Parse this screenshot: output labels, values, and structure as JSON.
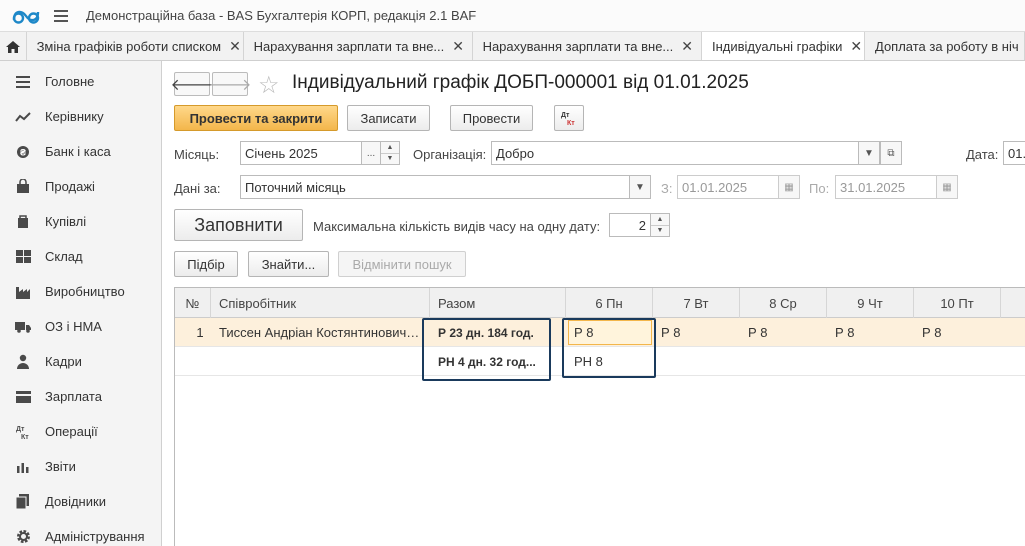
{
  "app": {
    "title": "Демонстраційна база - BAS Бухгалтерія КОРП, редакція 2.1 BAF"
  },
  "tabs": [
    {
      "label": "Зміна графіків роботи списком"
    },
    {
      "label": "Нарахування зарплати та вне..."
    },
    {
      "label": "Нарахування зарплати та вне..."
    },
    {
      "label": "Індивідуальні графіки"
    },
    {
      "label": "Доплата за роботу в ніч"
    }
  ],
  "sidebar": {
    "items": [
      {
        "label": "Головне",
        "icon": "menu-lines-icon"
      },
      {
        "label": "Керівнику",
        "icon": "trend-chart-icon"
      },
      {
        "label": "Банк і каса",
        "icon": "coin-icon"
      },
      {
        "label": "Продажі",
        "icon": "shopping-bag-icon"
      },
      {
        "label": "Купівлі",
        "icon": "cart-icon"
      },
      {
        "label": "Склад",
        "icon": "warehouse-icon"
      },
      {
        "label": "Виробництво",
        "icon": "factory-icon"
      },
      {
        "label": "ОЗ і НМА",
        "icon": "truck-icon"
      },
      {
        "label": "Кадри",
        "icon": "person-icon"
      },
      {
        "label": "Зарплата",
        "icon": "wallet-icon"
      },
      {
        "label": "Операції",
        "icon": "dt-kt-icon"
      },
      {
        "label": "Звіти",
        "icon": "bar-chart-icon"
      },
      {
        "label": "Довідники",
        "icon": "books-icon"
      },
      {
        "label": "Адміністрування",
        "icon": "gear-icon"
      }
    ]
  },
  "doc": {
    "title": "Індивідуальний графік ДОБП-000001 від 01.01.2025"
  },
  "toolbar": {
    "post_close": "Провести та закрити",
    "save": "Записати",
    "post": "Провести",
    "dtkt": "Дт Кт"
  },
  "form": {
    "month_label": "Місяць:",
    "month_value": "Січень 2025",
    "month_btn": "...",
    "org_label": "Організація:",
    "org_value": "Добро",
    "date_label": "Дата:",
    "date_value": "01.",
    "period_label": "Дані за:",
    "period_value": "Поточний місяць",
    "from_label": "З:",
    "from_value": "01.01.2025",
    "to_label": "По:",
    "to_value": "31.01.2025",
    "fill_btn": "Заповнити",
    "max_label": "Максимальна кількість видів часу на одну дату:",
    "max_value": "2"
  },
  "actions": {
    "select": "Підбір",
    "find": "Знайти...",
    "cancel_search": "Відмінити пошук"
  },
  "table": {
    "columns": [
      "№",
      "Співробітник",
      "Разом",
      "6 Пн",
      "7 Вт",
      "8 Ср",
      "9 Чт",
      "10 Пт"
    ],
    "rows": [
      {
        "num": "1",
        "employee": "Тиссен Андріан Костянтинович",
        "total_1": "Р 23 дн. 184 год.",
        "total_2": "РН 4 дн. 32 год.",
        "d6_1": "Р 8",
        "d6_2": "РН 8",
        "d7_1": "Р 8",
        "d8_1": "Р 8",
        "d9_1": "Р 8",
        "d10_1": "Р 8"
      }
    ]
  },
  "colors": {
    "primary_button": "#f3b64b",
    "highlight_border": "#1a3a5c",
    "selected_row": "#fdf0dc"
  }
}
